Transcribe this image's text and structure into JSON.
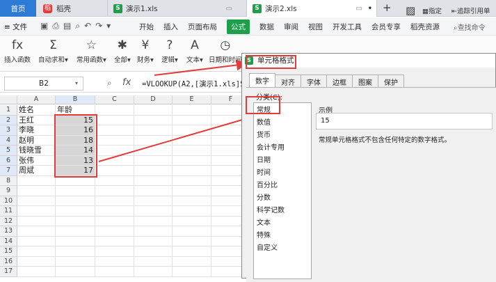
{
  "tabs": {
    "home": "首页",
    "daoke": "稻壳",
    "demo1": "演示1.xls",
    "demo2": "演示2.xls",
    "s_glyph": "S",
    "plus": "+"
  },
  "menubar": {
    "file": "文件",
    "items": [
      "开始",
      "插入",
      "页面布局",
      "公式",
      "数据",
      "审阅",
      "视图",
      "开发工具",
      "会员专享",
      "稻壳资源"
    ],
    "active_index": 3,
    "search": "查找命令"
  },
  "ribbon": {
    "buttons": [
      {
        "label": "插入函数",
        "icon": "fx"
      },
      {
        "label": "自动求和▾",
        "icon": "Σ"
      },
      {
        "label": "常用函数▾",
        "icon": "☆"
      },
      {
        "label": "全部▾",
        "icon": "✱"
      },
      {
        "label": "财务▾",
        "icon": "¥"
      },
      {
        "label": "逻辑▾",
        "icon": "?"
      },
      {
        "label": "文本▾",
        "icon": "A"
      },
      {
        "label": "日期和时间",
        "icon": "◷"
      }
    ],
    "right_1": "指定",
    "right_2": "追踪引用单"
  },
  "formula_bar": {
    "cell_ref": "B2",
    "fx": "fx",
    "formula": "=VLOOKUP(A2,[演示1.xls]S"
  },
  "sheet": {
    "columns": [
      "A",
      "B",
      "C",
      "D",
      "E",
      "F"
    ],
    "rows": [
      "1",
      "2",
      "3",
      "4",
      "5",
      "6",
      "7",
      "8",
      "9",
      "10",
      "11",
      "12",
      "13",
      "14",
      "15",
      "16",
      "17"
    ],
    "header": {
      "name": "姓名",
      "age": "年龄"
    },
    "data": [
      {
        "name": "王红",
        "age": "15"
      },
      {
        "name": "李晓",
        "age": "16"
      },
      {
        "name": "赵明",
        "age": "18"
      },
      {
        "name": "钱晓雪",
        "age": "14"
      },
      {
        "name": "张伟",
        "age": "13"
      },
      {
        "name": "周斌",
        "age": "17"
      }
    ]
  },
  "dialog": {
    "title": "单元格格式",
    "tabs": [
      "数字",
      "对齐",
      "字体",
      "边框",
      "图案",
      "保护"
    ],
    "active_tab": 0,
    "category_label": "分类(C):",
    "categories": [
      "常规",
      "数值",
      "货币",
      "会计专用",
      "日期",
      "时间",
      "百分比",
      "分数",
      "科学记数",
      "文本",
      "特殊",
      "自定义"
    ],
    "selected_category": 0,
    "sample_label": "示例",
    "sample_value": "15",
    "description": "常规单元格格式不包含任何特定的数字格式。"
  },
  "colors": {
    "accent_green": "#1f9e4c",
    "home_tab_blue": "#2e7bd6",
    "annotation_red": "#e23b3b"
  }
}
